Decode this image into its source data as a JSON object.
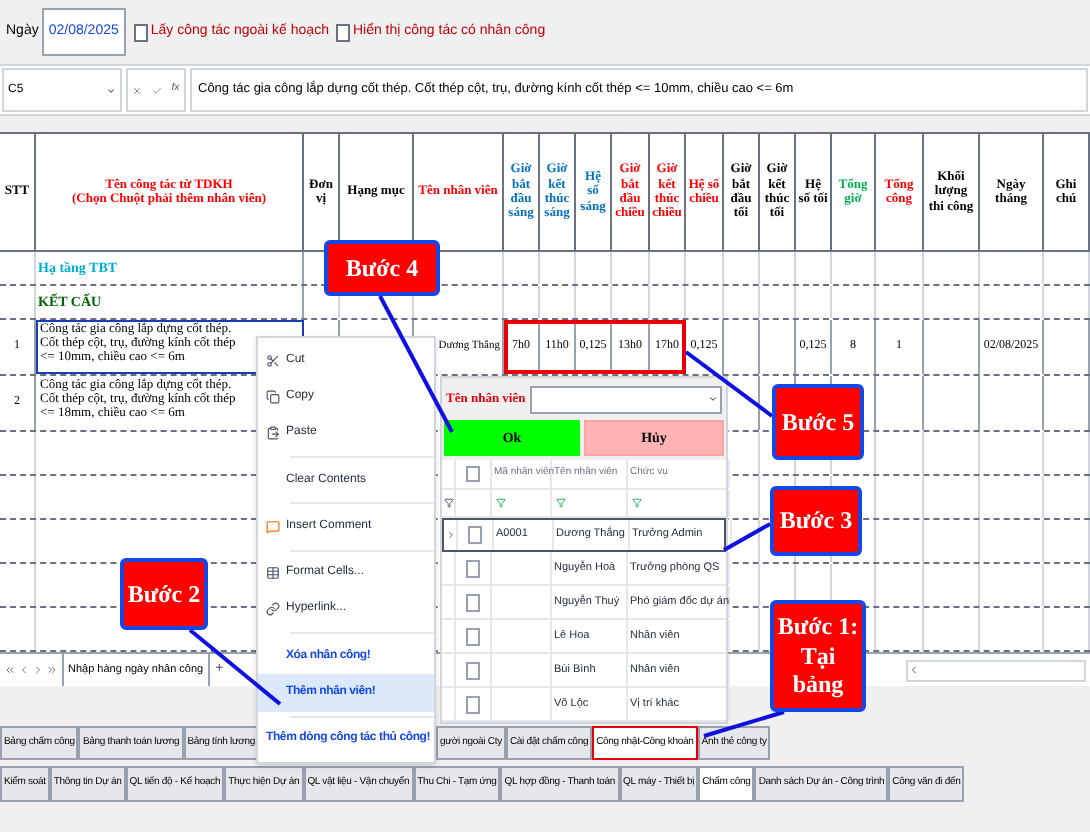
{
  "toolbar": {
    "date_label": "Ngày",
    "date": "02/08/2025",
    "options": [
      {
        "label": "Lấy công tác ngoài kế hoạch",
        "checked": false
      },
      {
        "label": "Hiển thị công tác có nhân công",
        "checked": false
      }
    ]
  },
  "formula_bar": {
    "cell": "C5",
    "fx": "fx",
    "formula": "Công tác gia công lắp dựng cốt thép. Cốt thép cột, trụ, đường kính cốt thép <= 10mm, chiều cao <= 6m"
  },
  "table": {
    "columns": [
      {
        "label": "STT",
        "color": "#000000"
      },
      {
        "label": "Tên công tác từ TDKH\n(Chọn Chuột phải thêm nhân viên)",
        "color": "#ff0000"
      },
      {
        "label": "Đơn vị",
        "color": "#000000"
      },
      {
        "label": "Hạng mục",
        "color": "#000000"
      },
      {
        "label": "Tên nhân viên",
        "color": "#ff0000"
      },
      {
        "label": "Giờ bắt đầu sáng",
        "color": "#0070c0"
      },
      {
        "label": "Giờ kết thúc sáng",
        "color": "#0070c0"
      },
      {
        "label": "Hệ số sáng",
        "color": "#0070c0"
      },
      {
        "label": "Giờ bắt đầu chiều",
        "color": "#ff0000"
      },
      {
        "label": "Giờ kết thúc chiều",
        "color": "#ff0000"
      },
      {
        "label": "Hệ số chiều",
        "color": "#ff0000"
      },
      {
        "label": "Giờ bắt đầu tối",
        "color": "#000000"
      },
      {
        "label": "Giờ kết thúc tối",
        "color": "#000000"
      },
      {
        "label": "Hệ số tối",
        "color": "#000000"
      },
      {
        "label": "Tổng giờ",
        "color": "#00b050"
      },
      {
        "label": "Tổng công",
        "color": "#ff0000"
      },
      {
        "label": "Khối lượng thi công",
        "color": "#000000"
      },
      {
        "label": "Ngày tháng",
        "color": "#000000"
      },
      {
        "label": "Ghi chú",
        "color": "#000000"
      }
    ],
    "rows": [
      {
        "kind": "group",
        "text": "Hạ tầng TBT",
        "color": "#00b0d0"
      },
      {
        "kind": "group",
        "text": "KẾT CẤU",
        "color": "#006400"
      },
      {
        "kind": "task",
        "selected": true,
        "times_highlighted": true,
        "cells": {
          "stt": "1",
          "task": "Công tác gia công lắp dựng cốt thép. Cốt thép cột, trụ, đường kính cốt thép <= 10mm, chiều cao <= 6m",
          "employee": "Dương Thắng",
          "start_morning": "7h0",
          "end_morning": "11h0",
          "coef_morning": "0,125",
          "start_afternoon": "13h0",
          "end_afternoon": "17h0",
          "coef_afternoon": "0,125",
          "coef_evening": "0,125",
          "total_hours": "8",
          "total_days": "1",
          "date": "02/08/2025"
        }
      },
      {
        "kind": "task",
        "selected": false,
        "times_highlighted": false,
        "cells": {
          "stt": "2",
          "task": "Công tác gia công lắp dựng cốt thép. Cốt thép cột, trụ, đường kính cốt thép <= 18mm, chiều cao <= 6m"
        }
      }
    ]
  },
  "context_menu": {
    "items": [
      {
        "label": "Cut",
        "kind": "command",
        "separator_before": false,
        "highlighted": false
      },
      {
        "label": "Copy",
        "kind": "command",
        "separator_before": false,
        "highlighted": false
      },
      {
        "label": "Paste",
        "kind": "command",
        "separator_before": false,
        "highlighted": false
      },
      {
        "label": "Clear Contents",
        "kind": "command",
        "separator_before": true,
        "highlighted": false
      },
      {
        "label": "Insert Comment",
        "kind": "command",
        "separator_before": true,
        "highlighted": false
      },
      {
        "label": "Format Cells...",
        "kind": "command",
        "separator_before": true,
        "highlighted": false
      },
      {
        "label": "Hyperlink...",
        "kind": "command",
        "separator_before": false,
        "highlighted": false
      },
      {
        "label": "Xóa nhân công!",
        "kind": "custom",
        "separator_before": true,
        "highlighted": false
      },
      {
        "label": "Thêm nhân viên!",
        "kind": "custom",
        "separator_before": false,
        "highlighted": true
      },
      {
        "label": "Thêm dòng công tác thủ công!",
        "kind": "custom",
        "separator_before": true,
        "highlighted": false
      }
    ]
  },
  "employee_dialog": {
    "label": "Tên nhân viên",
    "ok": "Ok",
    "cancel": "Hủy",
    "select_all_checked": false,
    "columns": [
      "Mã nhân viên",
      "Tên nhân viên",
      "Chức vụ"
    ],
    "rows": [
      {
        "code": "A0001",
        "name": "Dương Thắng",
        "position": "Trưởng Admin",
        "checked": false,
        "selected": true
      },
      {
        "name": "Nguyễn Hoà",
        "position": "Trưởng phòng QS",
        "checked": false,
        "selected": false
      },
      {
        "name": "Nguyễn Thuý",
        "position": "Phó giám đốc dự án",
        "checked": false,
        "selected": false
      },
      {
        "name": "Lê Hoa",
        "position": "Nhân viên",
        "checked": false,
        "selected": false
      },
      {
        "name": "Bùi Bình",
        "position": "Nhân viên",
        "checked": false,
        "selected": false
      },
      {
        "name": "Võ Lộc",
        "position": "Vị trí khác",
        "checked": false,
        "selected": false
      }
    ]
  },
  "sheet_bar": {
    "tabs": [
      {
        "label": "Nhập hàng ngày nhân công",
        "selected": true
      }
    ],
    "add": "+"
  },
  "module_tabs": {
    "row_1_left": [
      {
        "label": "Bảng chấm công",
        "selected": false,
        "annotated": false
      },
      {
        "label": "Bảng thanh toán lương",
        "selected": false,
        "annotated": false
      },
      {
        "label": "Bảng tính lương",
        "selected": false,
        "annotated": false
      }
    ],
    "row_1_right": [
      {
        "label": "gười ngoài Cty",
        "selected": false,
        "annotated": false
      },
      {
        "label": "Cài đặt chấm công",
        "selected": false,
        "annotated": false
      },
      {
        "label": "Công nhật-Công khoán",
        "selected": true,
        "annotated": true
      },
      {
        "label": "Ảnh thẻ công ty",
        "selected": false,
        "annotated": false
      }
    ],
    "row_2": [
      {
        "label": "Kiểm soát",
        "selected": false,
        "annotated": false
      },
      {
        "label": "Thông tin Dự án",
        "selected": false,
        "annotated": false
      },
      {
        "label": "QL tiến độ - Kế hoạch",
        "selected": false,
        "annotated": false
      },
      {
        "label": "Thực hiện Dự án",
        "selected": false,
        "annotated": false
      },
      {
        "label": "QL vật liệu - Vận chuyển",
        "selected": false,
        "annotated": false
      },
      {
        "label": "Thu Chi - Tạm ứng",
        "selected": false,
        "annotated": false
      },
      {
        "label": "QL hợp đồng - Thanh toán",
        "selected": false,
        "annotated": false
      },
      {
        "label": "QL máy - Thiết bị",
        "selected": false,
        "annotated": false
      },
      {
        "label": "Chấm công",
        "selected": true,
        "annotated": false
      },
      {
        "label": "Danh sách Dự án - Công trình",
        "selected": false,
        "annotated": false
      },
      {
        "label": "Công văn đi đến",
        "selected": false,
        "annotated": false
      }
    ]
  },
  "callouts": [
    {
      "text": "Bước 4"
    },
    {
      "text": "Bước 5"
    },
    {
      "text": "Bước 3"
    },
    {
      "text": "Bước 2"
    },
    {
      "text": "Bước 1:\nTại bảng"
    }
  ]
}
